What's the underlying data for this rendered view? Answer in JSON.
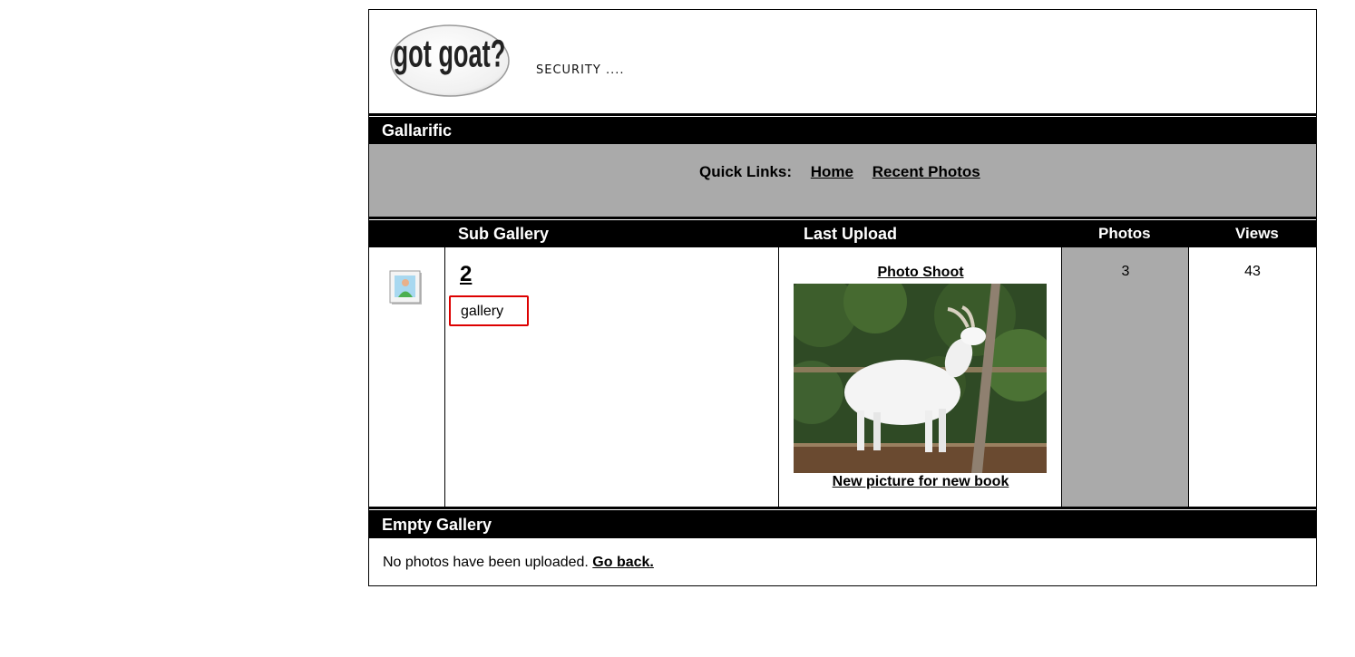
{
  "header": {
    "logo_text": "got goat?",
    "logo_icon": "oval-logo-icon",
    "tagline": "SECURITY ...."
  },
  "gallery_bar": {
    "title": "Gallarific"
  },
  "quick_links": {
    "label": "Quick Links:",
    "links": [
      "Home",
      "Recent Photos"
    ]
  },
  "columns": {
    "sub_gallery": "Sub Gallery",
    "last_upload": "Last Upload",
    "photos": "Photos",
    "views": "Views"
  },
  "row": {
    "icon": "gallery-photo-icon",
    "gallery_number": "2",
    "gallery_description": "gallery",
    "last_upload_title": "Photo Shoot",
    "last_upload_caption": "New picture for new book",
    "photos": "3",
    "views": "43"
  },
  "empty_bar": {
    "title": "Empty Gallery"
  },
  "empty_message": {
    "text": "No photos have been uploaded. ",
    "link": "Go back."
  },
  "colors": {
    "bar_background": "#000000",
    "quicklinks_background": "#aaaaaa",
    "highlight_border": "#dd0000"
  }
}
